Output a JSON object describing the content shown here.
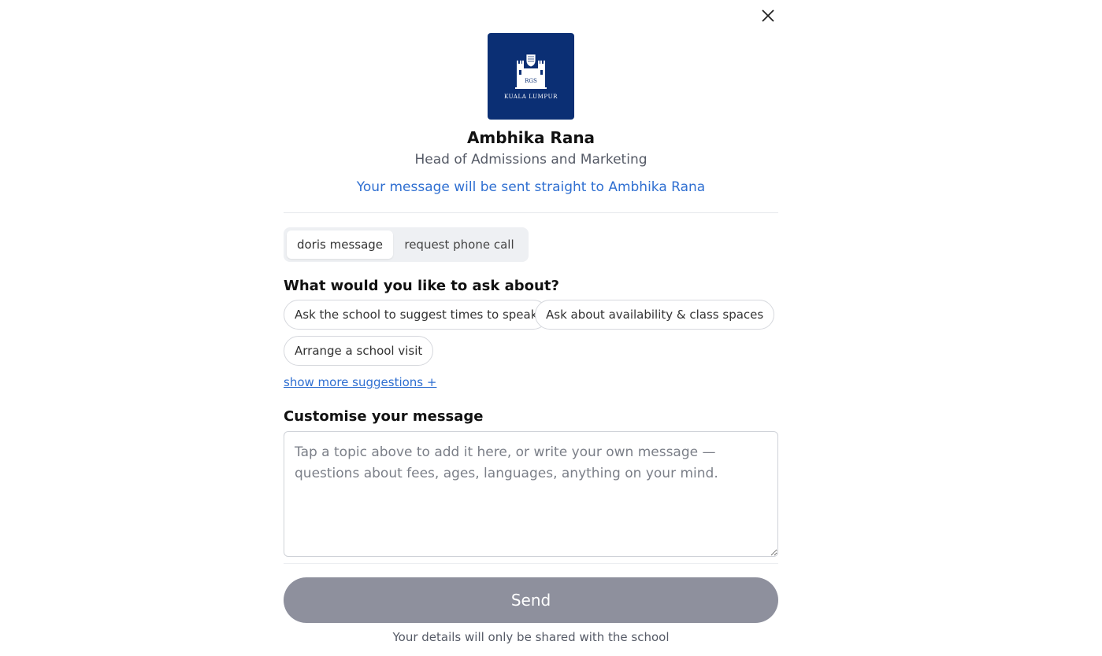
{
  "dialog": {
    "close_icon": "close-icon"
  },
  "contact": {
    "logo_icon": "school-crest-icon",
    "logo_text": "KUALA LUMPUR",
    "logo_initials": "RGS",
    "name": "Ambhika Rana",
    "role": "Head of Admissions and Marketing",
    "note": "Your message will be sent straight to Ambhika Rana"
  },
  "mode_toggle": {
    "options": [
      {
        "label": "doris message",
        "active": true
      },
      {
        "label": "request phone call",
        "active": false
      }
    ]
  },
  "suggestions": {
    "heading": "What would you like to ask about?",
    "chips": [
      "Ask the school to suggest times to speak",
      "Ask about availability & class spaces",
      "Arrange a school visit"
    ],
    "more_link": "show more suggestions +"
  },
  "message": {
    "heading": "Customise your message",
    "placeholder": "Tap a topic above to add it here, or write your own message — questions about fees, ages, languages, anything on your mind.",
    "value": ""
  },
  "footer": {
    "send_label": "Send",
    "privacy_note": "Your details will only be shared with the school"
  },
  "colors": {
    "accent": "#2f6fd1",
    "logo_bg": "#0b2f74",
    "send_disabled": "#8e909d"
  }
}
